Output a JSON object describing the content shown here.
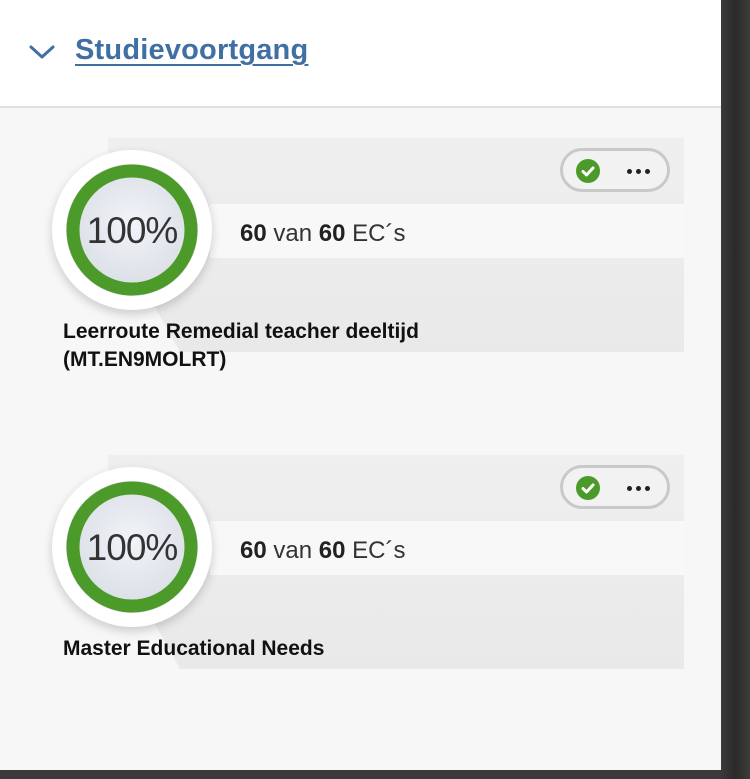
{
  "header": {
    "title": "Studievoortgang",
    "toggle_icon": "chevron-down-icon"
  },
  "colors": {
    "accent": "#3f6fa3",
    "progress": "#4c9a2a",
    "check": "#4c9a2a"
  },
  "programs": [
    {
      "percent_label": "100%",
      "progress": 1.0,
      "ec_earned": "60",
      "ec_word_van": "van",
      "ec_total": "60",
      "ec_unit": "EC´s",
      "name_line1": "Leerroute Remedial teacher deeltijd",
      "name_line2": "(MT.EN9MOLRT)",
      "status_icon": "check-circle-icon",
      "menu_icon": "more-icon"
    },
    {
      "percent_label": "100%",
      "progress": 1.0,
      "ec_earned": "60",
      "ec_word_van": "van",
      "ec_total": "60",
      "ec_unit": "EC´s",
      "name_line1": "Master Educational Needs",
      "status_icon": "check-circle-icon",
      "menu_icon": "more-icon"
    }
  ]
}
